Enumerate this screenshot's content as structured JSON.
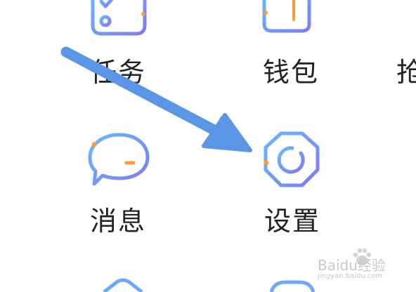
{
  "grid": {
    "items": [
      {
        "label": "任务",
        "icon": "task-list-icon"
      },
      {
        "label": "钱包",
        "icon": "wallet-icon"
      },
      {
        "label": "抢",
        "icon": "partial-item-icon"
      },
      {
        "label": "消息",
        "icon": "message-icon"
      },
      {
        "label": "设置",
        "icon": "settings-icon"
      }
    ]
  },
  "watermark": {
    "brand": "Baidu经验",
    "url": "jingyan.baidu.com"
  },
  "colors": {
    "icon_gradient_start": "#69b8ff",
    "icon_gradient_end": "#7e7bf0",
    "accent_orange": "#ff9a3c",
    "arrow": "#5b96e6"
  }
}
